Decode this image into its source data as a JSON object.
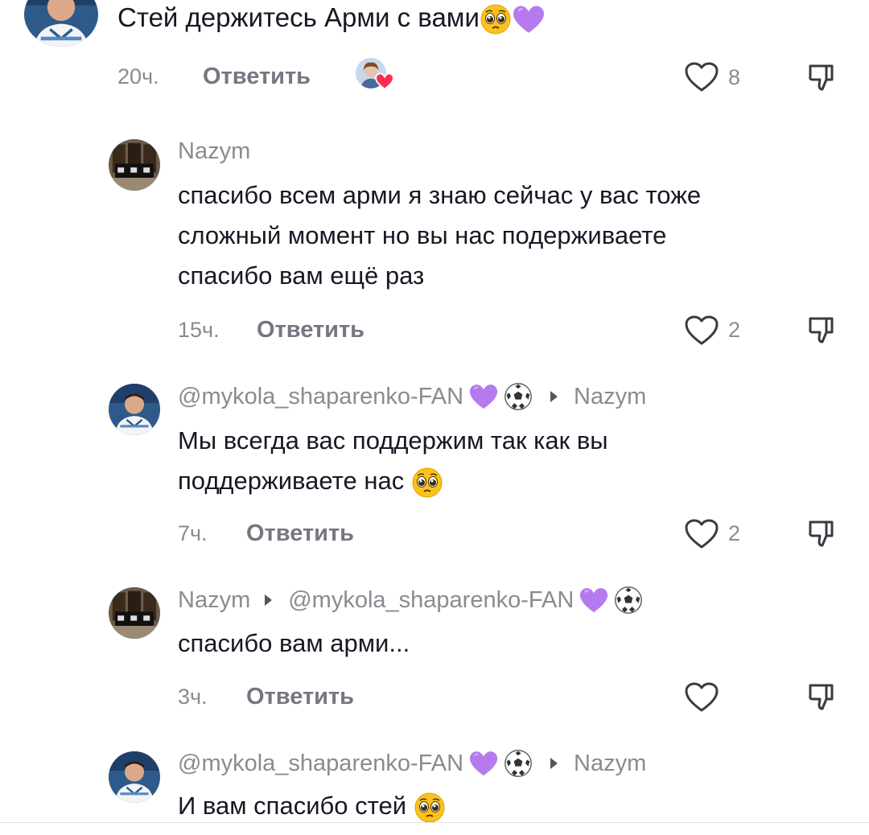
{
  "top_comment": {
    "text": "Стей держитесь Арми с вами",
    "time": "20ч.",
    "reply_label": "Ответить",
    "likes": "8"
  },
  "replies": [
    {
      "username": "Nazym",
      "reply_to": "",
      "text_lines": [
        "спасибо всем арми я знаю сейчас у вас тоже",
        "сложный момент но вы нас подерживаете",
        "спасибо вам ещё раз"
      ],
      "time": "15ч.",
      "reply_label": "Ответить",
      "likes": "2"
    },
    {
      "username": "@mykola_shaparenko-FAN",
      "reply_to": "Nazym",
      "text_lines": [
        "Мы всегда вас поддержим так как вы",
        "поддерживаете нас"
      ],
      "time": "7ч.",
      "reply_label": "Ответить",
      "likes": "2"
    },
    {
      "username": "Nazym",
      "reply_to": "@mykola_shaparenko-FAN",
      "text_lines": [
        "спасибо вам арми..."
      ],
      "time": "3ч.",
      "reply_label": "Ответить",
      "likes": ""
    },
    {
      "username": "@mykola_shaparenko-FAN",
      "reply_to": "Nazym",
      "text_lines": [
        "И вам спасибо стей"
      ],
      "time": "",
      "reply_label": "",
      "likes": ""
    }
  ],
  "colors": {
    "text": "#161823",
    "secondary": "#8a8b91",
    "reply": "#757680",
    "purple_heart": "#b57bee",
    "liked_heart": "#fe2c55"
  },
  "icons": [
    "heart-outline-icon",
    "dislike-icon",
    "purple-heart-emoji",
    "soccer-ball-emoji",
    "pleading-face-emoji",
    "author-liked-badge"
  ]
}
